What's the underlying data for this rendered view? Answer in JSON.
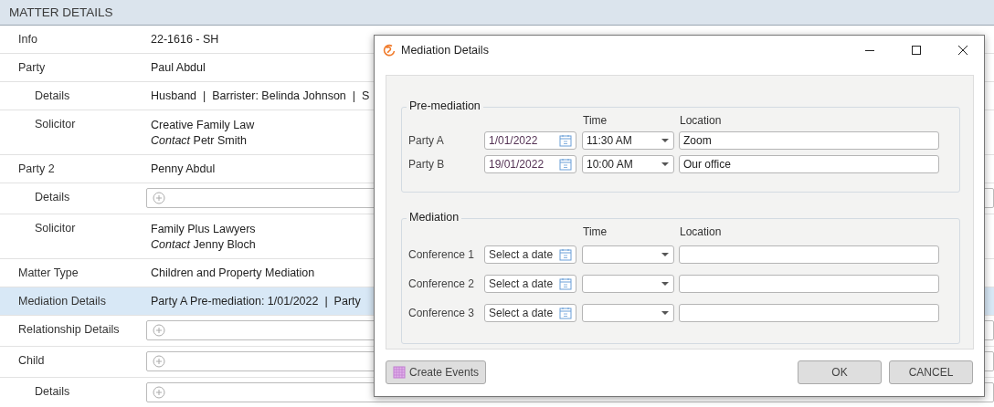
{
  "matter_details": {
    "title": "MATTER DETAILS",
    "rows": [
      {
        "label": "Info",
        "kind": "text",
        "value": "22-1616 - SH",
        "selected": false
      },
      {
        "label": "Party",
        "kind": "text",
        "value": "Paul Abdul",
        "selected": false,
        "children": [
          {
            "label": "Details",
            "kind": "text",
            "value": "Husband  |  Barrister: Belinda Johnson  |  S",
            "selected": false
          },
          {
            "label": "Solicitor",
            "kind": "lines",
            "lines": [
              "Creative Family Law",
              "*Contact* Petr Smith"
            ],
            "selected": false
          }
        ]
      },
      {
        "label": "Party 2",
        "kind": "text",
        "value": "Penny Abdul",
        "selected": false,
        "children": [
          {
            "label": "Details",
            "kind": "add",
            "selected": false
          },
          {
            "label": "Solicitor",
            "kind": "lines",
            "lines": [
              "Family Plus Lawyers",
              "*Contact* Jenny Bloch"
            ],
            "selected": false
          }
        ]
      },
      {
        "label": "Matter Type",
        "kind": "text",
        "value": "Children and Property Mediation",
        "selected": false
      },
      {
        "label": "Mediation Details",
        "kind": "text",
        "value": "Party A Pre-mediation: 1/01/2022  |  Party",
        "selected": true
      },
      {
        "label": "Relationship Details",
        "kind": "add",
        "selected": false
      },
      {
        "label": "Child",
        "kind": "add",
        "selected": false,
        "children": [
          {
            "label": "Details",
            "kind": "add",
            "selected": false
          }
        ]
      }
    ]
  },
  "dialog": {
    "title": "Mediation Details",
    "sections": [
      {
        "title": "Pre-mediation",
        "time_header": "Time",
        "location_header": "Location",
        "rows": [
          {
            "label": "Party A",
            "date": {
              "value": "1/01/2022"
            },
            "time": {
              "value": "11:30 AM"
            },
            "location": {
              "value": "Zoom"
            }
          },
          {
            "label": "Party B",
            "date": {
              "value": "19/01/2022"
            },
            "time": {
              "value": "10:00 AM"
            },
            "location": {
              "value": "Our office"
            }
          }
        ]
      },
      {
        "title": "Mediation",
        "time_header": "Time",
        "location_header": "Location",
        "rows": [
          {
            "label": "Conference 1",
            "date": {
              "placeholder": "Select a date"
            },
            "time": {},
            "location": {}
          },
          {
            "label": "Conference 2",
            "date": {
              "placeholder": "Select a date"
            },
            "time": {},
            "location": {}
          },
          {
            "label": "Conference 3",
            "date": {
              "placeholder": "Select a date"
            },
            "time": {},
            "location": {}
          }
        ]
      }
    ],
    "create_button": {
      "label": "Create Events"
    },
    "ok_button": {
      "label": "OK"
    },
    "cancel_button": {
      "label": "CANCEL"
    }
  }
}
